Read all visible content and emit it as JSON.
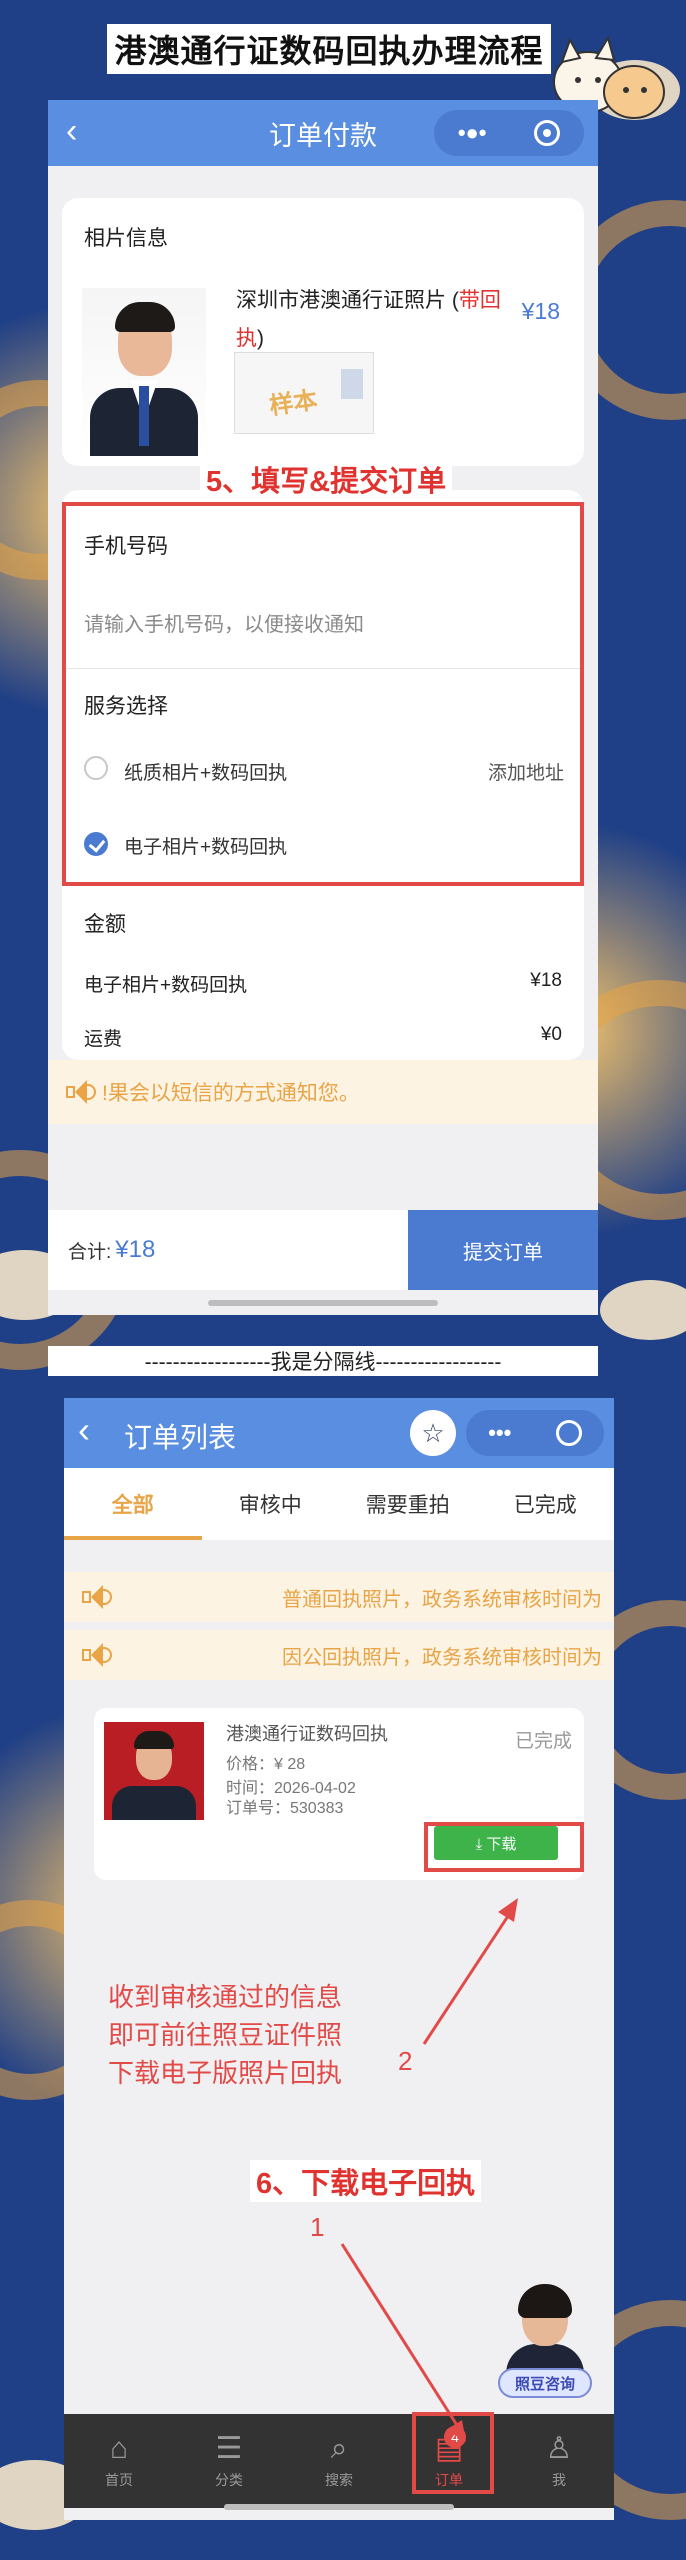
{
  "header": {
    "title": "港澳通行证数码回执办理流程"
  },
  "screen1": {
    "nav_title": "订单付款",
    "back_icon": "‹",
    "photo_section_label": "相片信息",
    "product_name_prefix": "深圳市港澳通行证照片 (",
    "product_name_highlight": "带回执",
    "product_name_suffix": ")",
    "price": "¥18",
    "sample_stamp": "样本",
    "step5_label": "5、填写&提交订单",
    "phone_label": "手机号码",
    "phone_placeholder": "请输入手机号码，以便接收通知",
    "service_label": "服务选择",
    "service_options": [
      {
        "label": "纸质相片+数码回执",
        "selected": false,
        "extra": "添加地址"
      },
      {
        "label": "电子相片+数码回执",
        "selected": true,
        "extra": ""
      }
    ],
    "amount_label": "金额",
    "amount_rows": [
      {
        "label": "电子相片+数码回执",
        "value": "¥18"
      },
      {
        "label": "运费",
        "value": "¥0"
      }
    ],
    "notice": "!果会以短信的方式通知您。",
    "total_label": "合计:",
    "total_value": "¥18",
    "submit_label": "提交订单"
  },
  "separator": {
    "text": "------------------我是分隔线------------------"
  },
  "screen2": {
    "nav_title": "订单列表",
    "back_icon": "‹",
    "tabs": [
      {
        "label": "全部",
        "active": true
      },
      {
        "label": "审核中",
        "active": false
      },
      {
        "label": "需要重拍",
        "active": false
      },
      {
        "label": "已完成",
        "active": false
      }
    ],
    "notices": [
      "普通回执照片，政务系统审核时间为",
      "因公回执照片，政务系统审核时间为"
    ],
    "order": {
      "title": "港澳通行证数码回执",
      "status": "已完成",
      "price": "价格：¥ 28",
      "time": "时间：2026-04-02",
      "order_no": "订单号：530383",
      "download_label": "⤓ 下载"
    },
    "annotation_text": [
      "收到审核通过的信息",
      "即可前往照豆证件照",
      "下载电子版照片回执"
    ],
    "annotation_num_2": "2",
    "step6_label": "6、下载电子回执",
    "annotation_num_1": "1",
    "consult_label": "照豆咨询",
    "tabbar": [
      {
        "label": "首页",
        "icon": "home-icon",
        "glyph": "⌂",
        "active": false
      },
      {
        "label": "分类",
        "icon": "category-icon",
        "glyph": "☰",
        "active": false
      },
      {
        "label": "搜索",
        "icon": "search-icon",
        "glyph": "⌕",
        "active": false
      },
      {
        "label": "订单",
        "icon": "order-icon",
        "glyph": "▤",
        "active": true,
        "badge": "4"
      },
      {
        "label": "我",
        "icon": "user-icon",
        "glyph": "♙",
        "active": false
      }
    ]
  },
  "colors": {
    "brand_blue": "#5a8ee0",
    "accent_orange": "#e8a446",
    "annotation_red": "#e24a48",
    "download_green": "#3db34a"
  }
}
